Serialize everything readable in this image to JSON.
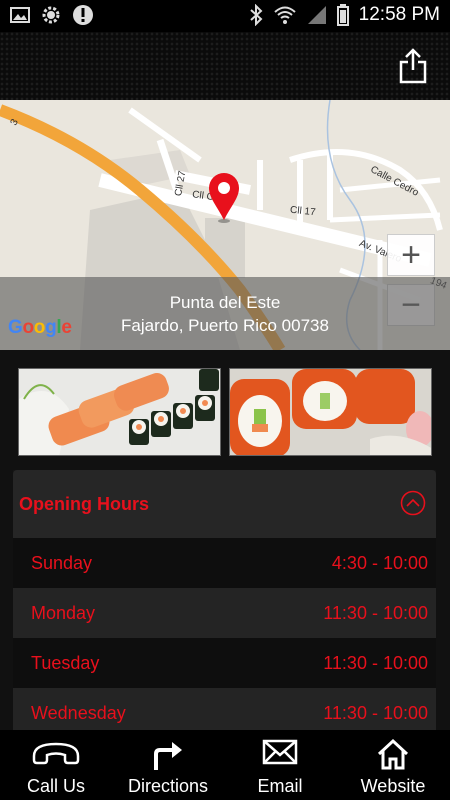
{
  "status_bar": {
    "time": "12:58 PM"
  },
  "map": {
    "street_labels": [
      "Cll 27",
      "Cll Ceiba",
      "Cll 17",
      "Calle Cedro",
      "Av. Valero",
      "194",
      "3"
    ],
    "address_line1": "Punta del Este",
    "address_line2": "Fajardo, Puerto Rico 00738",
    "zoom_in": "+",
    "zoom_out": "−",
    "logo": "Google"
  },
  "photos": [
    "salmon-nigiri-sushi-photo",
    "tobiko-roll-sushi-photo"
  ],
  "hours": {
    "title": "Opening Hours",
    "rows": [
      {
        "day": "Sunday",
        "time": "4:30 - 10:00"
      },
      {
        "day": "Monday",
        "time": "11:30 - 10:00"
      },
      {
        "day": "Tuesday",
        "time": "11:30 - 10:00"
      },
      {
        "day": "Wednesday",
        "time": "11:30 - 10:00"
      }
    ]
  },
  "bottom_nav": {
    "call": "Call Us",
    "directions": "Directions",
    "email": "Email",
    "website": "Website"
  },
  "colors": {
    "accent": "#e8101c",
    "route": "#f2a53a"
  }
}
